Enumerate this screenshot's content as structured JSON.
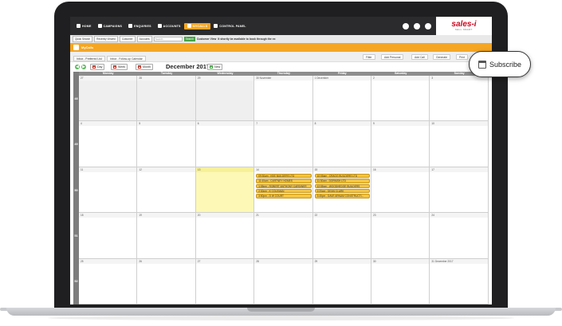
{
  "nav": {
    "items": [
      {
        "label": "HOME"
      },
      {
        "label": "CAMPAIGNS"
      },
      {
        "label": "ENQUIRIES"
      },
      {
        "label": "ACCOUNTS"
      },
      {
        "label": "MYCALLS"
      },
      {
        "label": "CONTROL PANEL"
      }
    ],
    "active_index": 4,
    "brand": "sales-i",
    "brand_sub": "SELL SMART"
  },
  "searchbar": {
    "quick_search": "Quick Search",
    "recently_viewed": "Recently Viewed",
    "customer_select": "Customer",
    "accounts_select": "Accounts",
    "search_placeholder": "Search...",
    "go_label": "Search",
    "customer_view_label": "Customer View",
    "notice": "It shortly be available to book through the ex"
  },
  "page": {
    "title": "MyCalls",
    "tabs": [
      {
        "label": "Inbox - Preferred List"
      },
      {
        "label": "Inbox - Follow-up Calendar"
      }
    ],
    "toolbar": {
      "filter": "Filter",
      "add_personal": "Add Personal",
      "add_call": "Add Call",
      "generate": "Generate",
      "print": "Print"
    }
  },
  "calendar": {
    "prev_label": "◀",
    "next_label": "▶",
    "views": {
      "day": "Day",
      "week": "Week",
      "month": "Month"
    },
    "title": "December 2017",
    "new_label": "New",
    "day_headers": [
      "Monday",
      "Tuesday",
      "Wednesday",
      "Thursday",
      "Friday",
      "Saturday",
      "Sunday"
    ],
    "weeks": [
      {
        "week": "48",
        "days": [
          "27",
          "28",
          "29",
          "30 November",
          "1 December",
          "2",
          "3"
        ]
      },
      {
        "week": "49",
        "days": [
          "4",
          "5",
          "6",
          "7",
          "8",
          "9",
          "10"
        ]
      },
      {
        "week": "50",
        "days": [
          "11",
          "12",
          "13",
          "14",
          "15",
          "16",
          "17"
        ]
      },
      {
        "week": "51",
        "days": [
          "18",
          "19",
          "20",
          "21",
          "22",
          "23",
          "24"
        ]
      },
      {
        "week": "52",
        "days": [
          "25",
          "26",
          "27",
          "28",
          "29",
          "30",
          "31 December 2017"
        ]
      }
    ],
    "events_thursday": [
      "09:30am - KBS BUILDERS LTD",
      "11:40am - CARTNEY HOMES",
      "1:05pm - ROBERT ANTHONY CARDINER",
      "2:30pm - K COLEMAN",
      "3:50pm - D W COURT"
    ],
    "events_friday": [
      "10:05am - CRAGG BUILDERS LTD",
      "11:30am - DORNISH LTD",
      "12:55pm - WOODHEDGE BUILDERS",
      "2:20pm - DEAN CLARK",
      "3:45pm - DAVE ARNAM CONSTRUCTI..."
    ]
  },
  "subscribe": {
    "label": "Subscribe"
  },
  "colors": {
    "nav_bg": "#2b2b2d",
    "accent": "#f5a623",
    "event": "#f4c542",
    "today": "#fdf8b5",
    "brand_red": "#d0021b"
  }
}
